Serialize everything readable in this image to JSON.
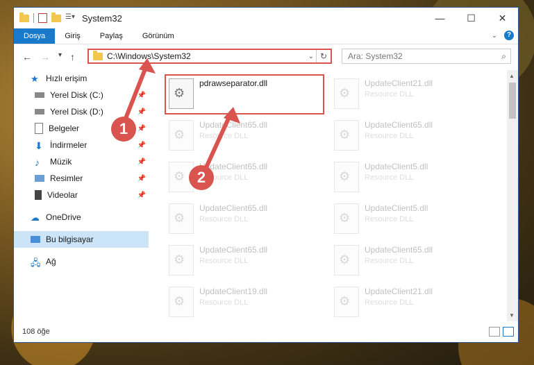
{
  "window": {
    "title": "System32",
    "minimize": "—",
    "maximize": "☐",
    "close": "✕"
  },
  "ribbon": {
    "tabs": [
      "Dosya",
      "Giriş",
      "Paylaş",
      "Görünüm"
    ],
    "expand_icon": "chevron-down-icon",
    "help": "?"
  },
  "nav": {
    "back": "←",
    "forward": "→",
    "recent": "▾",
    "up": "↑"
  },
  "address": {
    "path": "C:\\Windows\\System32",
    "dropdown": "⌄",
    "refresh": "↻"
  },
  "search": {
    "placeholder": "Ara: System32",
    "icon": "⌕"
  },
  "sidebar": {
    "quick_access": "Hızlı erişim",
    "items": [
      {
        "label": "Yerel Disk (C:)",
        "icon": "drive-icon",
        "pinned": true
      },
      {
        "label": "Yerel Disk (D:)",
        "icon": "drive-icon",
        "pinned": true
      },
      {
        "label": "Belgeler",
        "icon": "documents-icon",
        "pinned": true
      },
      {
        "label": "İndirmeler",
        "icon": "downloads-icon",
        "pinned": true
      },
      {
        "label": "Müzik",
        "icon": "music-icon",
        "pinned": true
      },
      {
        "label": "Resimler",
        "icon": "pictures-icon",
        "pinned": true
      },
      {
        "label": "Videolar",
        "icon": "videos-icon",
        "pinned": true
      }
    ],
    "onedrive": "OneDrive",
    "this_pc": "Bu bilgisayar",
    "network": "Ağ"
  },
  "files": {
    "left": [
      {
        "name": "pdrawseparator.dll",
        "type": ""
      },
      {
        "name": "UpdateClient65.dll",
        "type": "Resource DLL"
      },
      {
        "name": "UpdateClient65.dll",
        "type": "Resource DLL"
      },
      {
        "name": "UpdateClient65.dll",
        "type": "Resource DLL"
      },
      {
        "name": "UpdateClient65.dll",
        "type": "Resource DLL"
      },
      {
        "name": "UpdateClient19.dll",
        "type": "Resource DLL"
      }
    ],
    "right": [
      {
        "name": "UpdateClient21.dll",
        "type": "Resource DLL"
      },
      {
        "name": "UpdateClient65.dll",
        "type": "Resource DLL"
      },
      {
        "name": "UpdateClient5.dll",
        "type": "Resource DLL"
      },
      {
        "name": "UpdateClient5.dll",
        "type": "Resource DLL"
      },
      {
        "name": "UpdateClient65.dll",
        "type": "Resource DLL"
      },
      {
        "name": "UpdateClient21.dll",
        "type": "Resource DLL"
      }
    ]
  },
  "status": {
    "count": "108 öğe"
  },
  "callouts": [
    "1",
    "2"
  ],
  "colors": {
    "accent": "#1979ca",
    "highlight": "#d9534f",
    "selected": "#cce4f7"
  }
}
